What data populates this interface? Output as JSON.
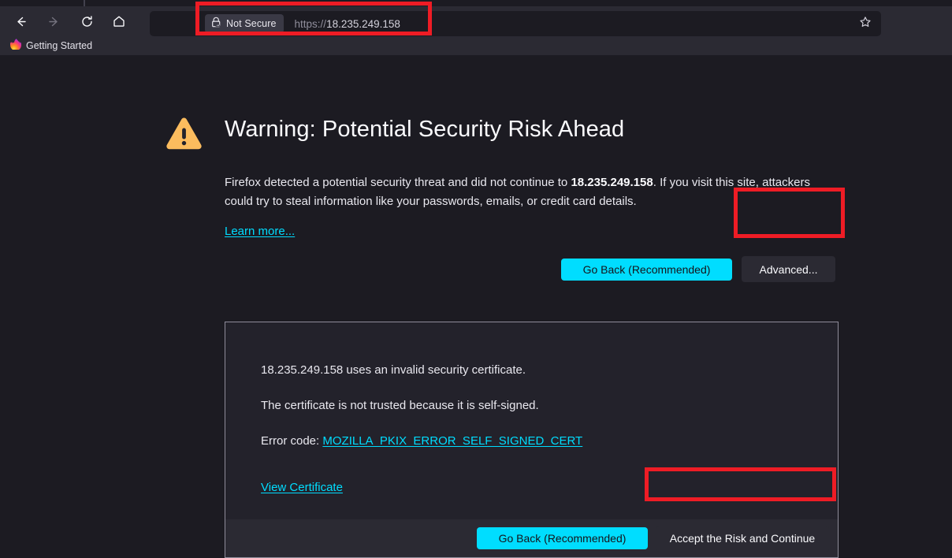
{
  "browser": {
    "nav": {
      "back": "back-arrow",
      "forward": "forward-arrow",
      "reload": "reload",
      "home": "home"
    },
    "urlbar": {
      "identity_label": "Not Secure",
      "identity_icon": "lock-warning-icon",
      "url_scheme": "https://",
      "url_host": "18.235.249.158",
      "bookmark_icon": "star-icon"
    },
    "bookmarks": [
      {
        "label": "Getting Started",
        "icon": "firefox-icon"
      }
    ]
  },
  "page": {
    "warning_icon": "warning-triangle-icon",
    "title": "Warning: Potential Security Risk Ahead",
    "body_prefix": "Firefox detected a potential security threat and did not continue to ",
    "body_host": "18.235.249.158",
    "body_suffix": ". If you visit this site, attackers could try to steal information like your passwords, emails, or credit card details.",
    "learn_more": "Learn more...",
    "go_back_label": "Go Back (Recommended)",
    "advanced_label": "Advanced...",
    "advanced_panel": {
      "line_1": "18.235.249.158 uses an invalid security certificate.",
      "line_2": "The certificate is not trusted because it is self-signed.",
      "error_code_prefix": "Error code: ",
      "error_code": "MOZILLA_PKIX_ERROR_SELF_SIGNED_CERT",
      "view_certificate": "View Certificate",
      "go_back_label": "Go Back (Recommended)",
      "accept_label": "Accept the Risk and Continue"
    }
  },
  "colors": {
    "accent": "#00ddff",
    "warning": "#fbbc5e",
    "annotation": "#ee1c25",
    "chrome_bg": "#2b2a33",
    "content_bg": "#1c1b22"
  },
  "annotations": [
    {
      "name": "url-bar-highlight"
    },
    {
      "name": "advanced-button-highlight"
    },
    {
      "name": "accept-risk-button-highlight"
    }
  ]
}
